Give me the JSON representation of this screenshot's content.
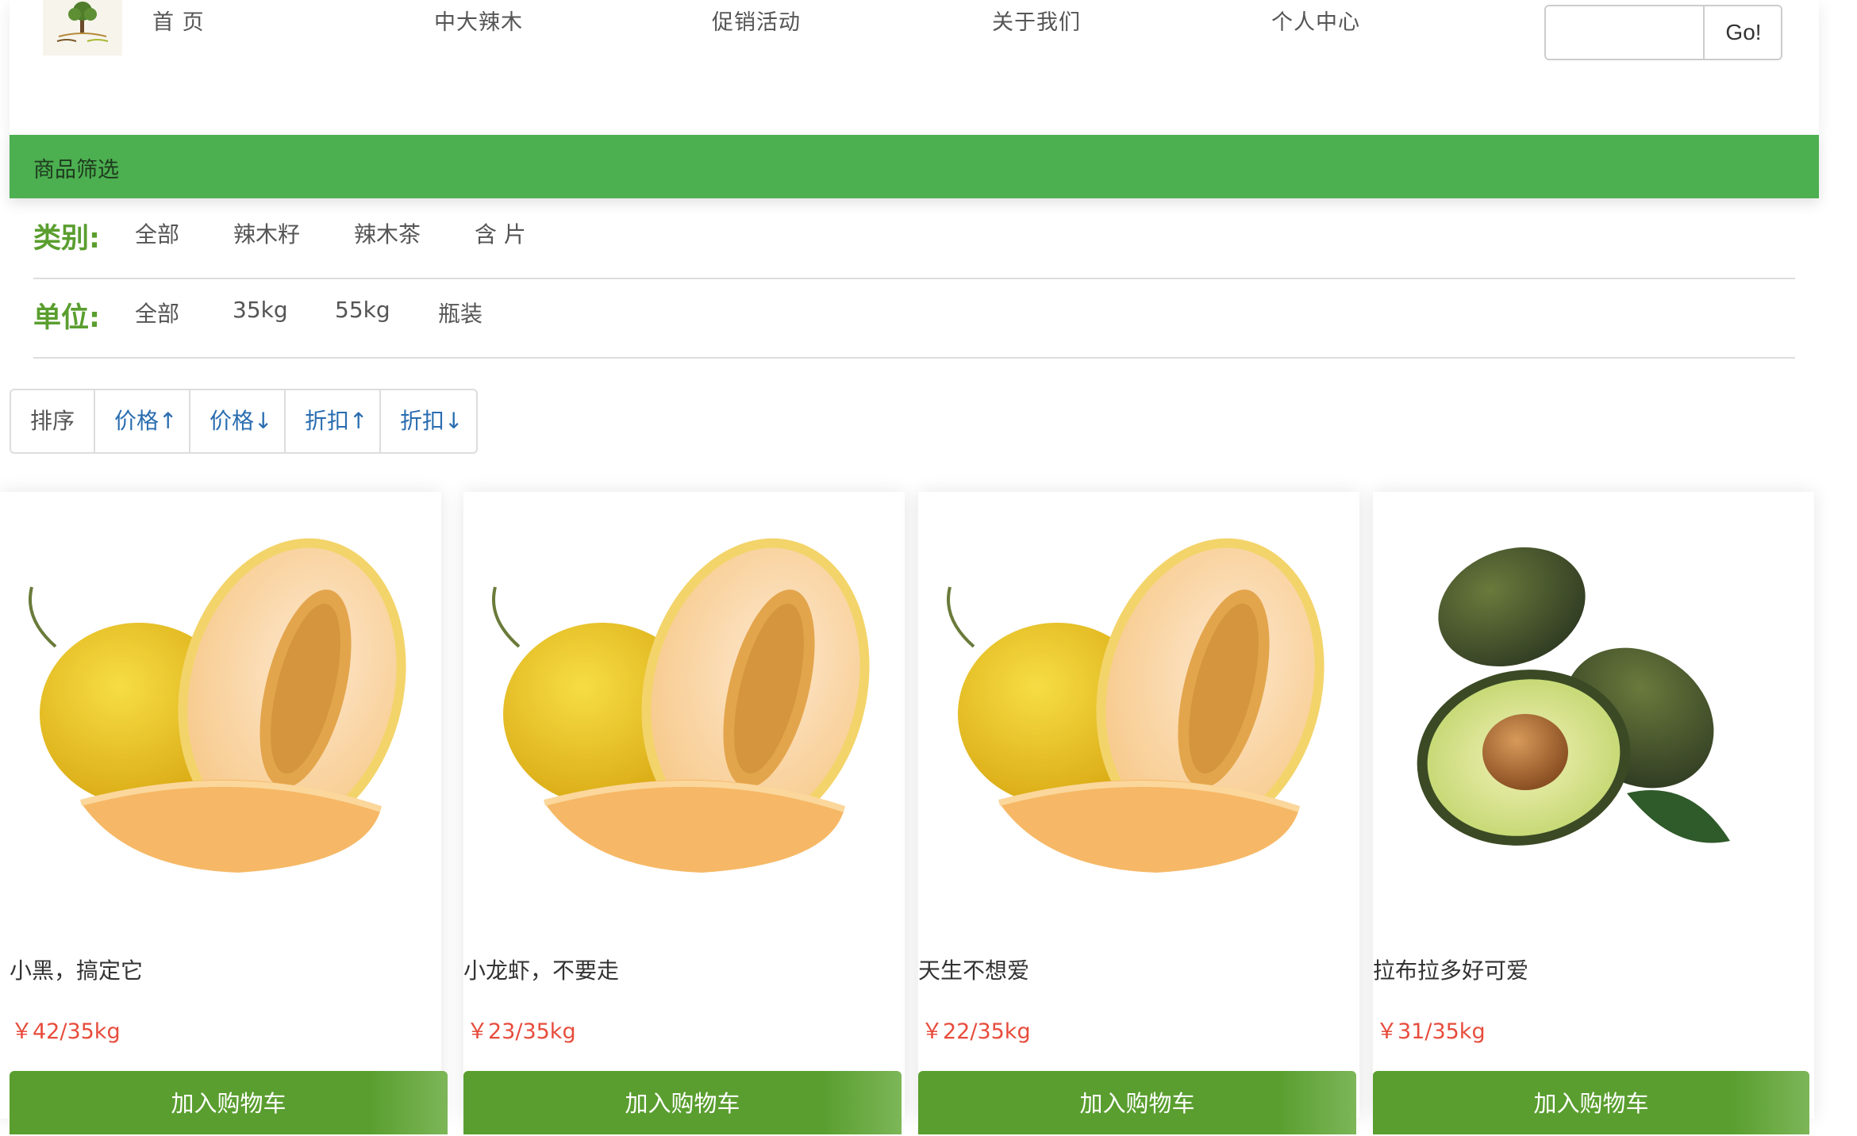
{
  "header": {
    "nav": [
      "首 页",
      "中大辣木",
      "促销活动",
      "关于我们",
      "个人中心"
    ],
    "search": {
      "placeholder": "",
      "button_label": "Go!"
    }
  },
  "filter": {
    "title": "商品筛选",
    "category": {
      "label": "类别:",
      "options": [
        "全部",
        "辣木籽",
        "辣木茶",
        "含 片"
      ]
    },
    "unit": {
      "label": "单位:",
      "options": [
        "全部",
        "35kg",
        "55kg",
        "瓶装"
      ]
    }
  },
  "sort": {
    "label": "排序",
    "options": [
      "价格↑",
      "价格↓",
      "折扣↑",
      "折扣↓"
    ]
  },
  "products": [
    {
      "name": "小黑，搞定它",
      "price": "￥42/35kg",
      "button": "加入购物车",
      "image": "melon"
    },
    {
      "name": "小龙虾，不要走",
      "price": "￥23/35kg",
      "button": "加入购物车",
      "image": "melon"
    },
    {
      "name": "天生不想爱",
      "price": "￥22/35kg",
      "button": "加入购物车",
      "image": "melon"
    },
    {
      "name": "拉布拉多好可爱",
      "price": "￥31/35kg",
      "button": "加入购物车",
      "image": "avocado"
    }
  ],
  "colors": {
    "accent_green": "#4caf50",
    "button_green": "#5a9e2f",
    "price_red": "#e74c3c",
    "link_blue": "#2a6db0"
  }
}
